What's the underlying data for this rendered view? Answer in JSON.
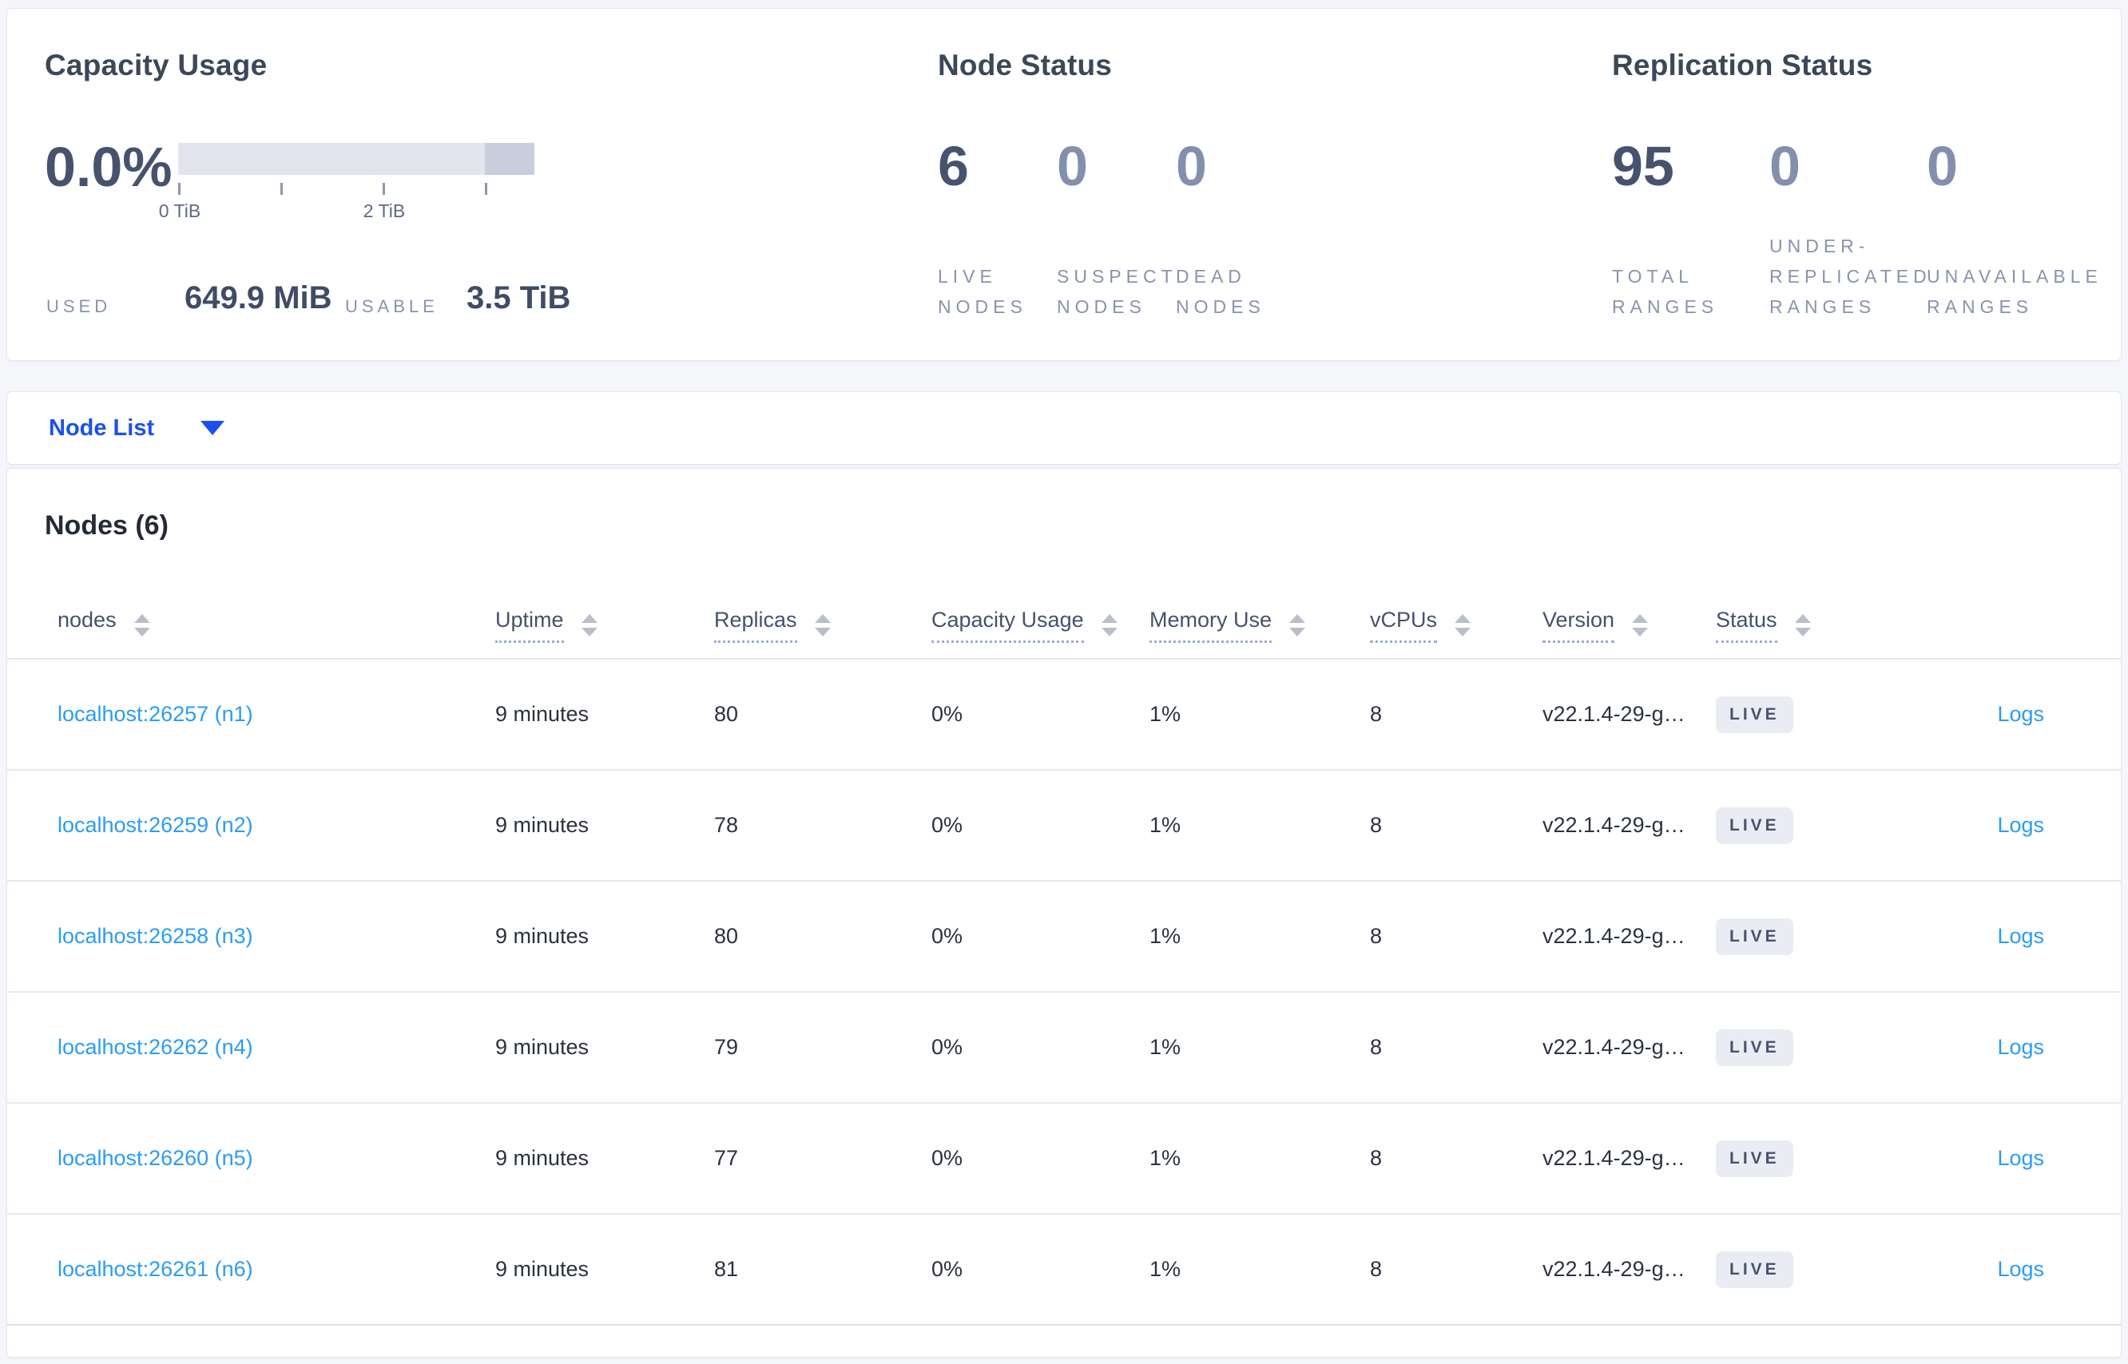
{
  "summary": {
    "capacity": {
      "title": "Capacity Usage",
      "percent": "0.0%",
      "tick_labels": [
        "0 TiB",
        "2 TiB"
      ],
      "used_label": "USED",
      "used_value": "649.9 MiB",
      "usable_label": "USABLE",
      "usable_value": "3.5 TiB"
    },
    "node_status": {
      "title": "Node Status",
      "stats": [
        {
          "value": "6",
          "label": "LIVE\nNODES"
        },
        {
          "value": "0",
          "label": "SUSPECT\nNODES"
        },
        {
          "value": "0",
          "label": "DEAD\nNODES"
        }
      ]
    },
    "replication": {
      "title": "Replication Status",
      "stats": [
        {
          "value": "95",
          "label": "TOTAL\nRANGES"
        },
        {
          "value": "0",
          "label": "UNDER-\nREPLICATED\nRANGES"
        },
        {
          "value": "0",
          "label": "UNAVAILABLE\nRANGES"
        }
      ]
    }
  },
  "node_list_dropdown": {
    "label": "Node List"
  },
  "nodes_table": {
    "heading": "Nodes (6)",
    "columns": [
      {
        "label": "nodes"
      },
      {
        "label": "Uptime"
      },
      {
        "label": "Replicas"
      },
      {
        "label": "Capacity Usage"
      },
      {
        "label": "Memory Use"
      },
      {
        "label": "vCPUs"
      },
      {
        "label": "Version"
      },
      {
        "label": "Status"
      }
    ],
    "rows": [
      {
        "address": "localhost:26257 (n1)",
        "uptime": "9 minutes",
        "replicas": "80",
        "capacity_usage": "0%",
        "memory_use": "1%",
        "vcpus": "8",
        "version": "v22.1.4-29-g…",
        "status": "LIVE",
        "logs": "Logs"
      },
      {
        "address": "localhost:26259 (n2)",
        "uptime": "9 minutes",
        "replicas": "78",
        "capacity_usage": "0%",
        "memory_use": "1%",
        "vcpus": "8",
        "version": "v22.1.4-29-g…",
        "status": "LIVE",
        "logs": "Logs"
      },
      {
        "address": "localhost:26258 (n3)",
        "uptime": "9 minutes",
        "replicas": "80",
        "capacity_usage": "0%",
        "memory_use": "1%",
        "vcpus": "8",
        "version": "v22.1.4-29-g…",
        "status": "LIVE",
        "logs": "Logs"
      },
      {
        "address": "localhost:26262 (n4)",
        "uptime": "9 minutes",
        "replicas": "79",
        "capacity_usage": "0%",
        "memory_use": "1%",
        "vcpus": "8",
        "version": "v22.1.4-29-g…",
        "status": "LIVE",
        "logs": "Logs"
      },
      {
        "address": "localhost:26260 (n5)",
        "uptime": "9 minutes",
        "replicas": "77",
        "capacity_usage": "0%",
        "memory_use": "1%",
        "vcpus": "8",
        "version": "v22.1.4-29-g…",
        "status": "LIVE",
        "logs": "Logs"
      },
      {
        "address": "localhost:26261 (n6)",
        "uptime": "9 minutes",
        "replicas": "81",
        "capacity_usage": "0%",
        "memory_use": "1%",
        "vcpus": "8",
        "version": "v22.1.4-29-g…",
        "status": "LIVE",
        "logs": "Logs"
      }
    ]
  },
  "colors": {
    "accent_blue": "#1b50f0",
    "link_blue": "#2a9df4",
    "badge_bg": "#e9edf3",
    "bar_track": "#e2e5ed",
    "bar_segment": "#c9cede",
    "page_bg": "#f4f6fa"
  }
}
